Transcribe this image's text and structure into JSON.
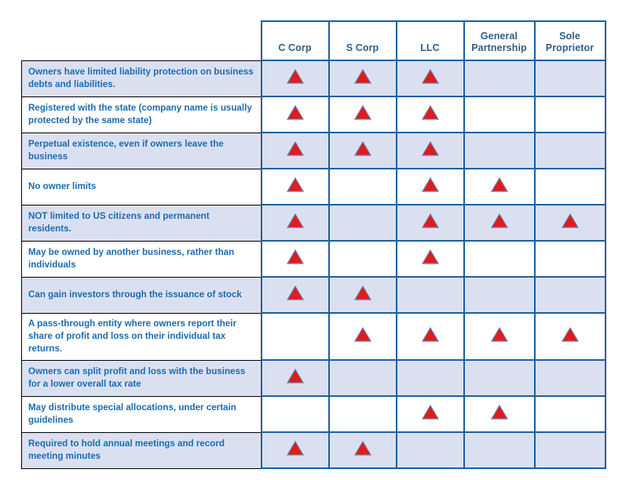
{
  "table": {
    "corner_label": "",
    "columns": [
      {
        "id": "c_corp",
        "label": "C Corp"
      },
      {
        "id": "s_corp",
        "label": "S Corp"
      },
      {
        "id": "llc",
        "label": "LLC"
      },
      {
        "id": "general_partnership",
        "label": "General Partnership"
      },
      {
        "id": "sole_proprietor",
        "label": "Sole Proprietor"
      }
    ],
    "marker": {
      "name": "red-triangle-marker",
      "glyph": "▲",
      "fill_color": "#E21A1A",
      "stroke_color": "#6E7FA8",
      "meaning": "feature applies"
    },
    "colors": {
      "border_blue": "#1A5FA0",
      "border_black": "#000000",
      "row_shaded_background": "#DBE0F1",
      "row_plain_background": "#FFFFFF",
      "header_text": "#2E5E8C",
      "label_text": "#1B6CB0"
    },
    "rows": [
      {
        "label": "Owners have limited liability protection on business debts and liabilities.",
        "shaded": true,
        "marks": [
          true,
          true,
          true,
          false,
          false
        ]
      },
      {
        "label": "Registered with the state (company name is usually protected by the same state)",
        "shaded": false,
        "marks": [
          true,
          true,
          true,
          false,
          false
        ]
      },
      {
        "label": "Perpetual existence, even if owners leave the business",
        "shaded": true,
        "marks": [
          true,
          true,
          true,
          false,
          false
        ]
      },
      {
        "label": "No owner limits",
        "shaded": false,
        "marks": [
          true,
          false,
          true,
          true,
          false
        ]
      },
      {
        "label": "NOT limited to US citizens and permanent residents.",
        "shaded": true,
        "marks": [
          true,
          false,
          true,
          true,
          true
        ]
      },
      {
        "label": "May be owned by another business, rather than individuals",
        "shaded": false,
        "marks": [
          true,
          false,
          true,
          false,
          false
        ]
      },
      {
        "label": "Can gain investors through the issuance of stock",
        "shaded": true,
        "marks": [
          true,
          true,
          false,
          false,
          false
        ]
      },
      {
        "label": "A pass-through entity where owners report their share of profit and loss on their individual tax returns.",
        "shaded": false,
        "marks": [
          false,
          true,
          true,
          true,
          true
        ]
      },
      {
        "label": "Owners can split profit and loss with the business for a lower overall tax rate",
        "shaded": true,
        "marks": [
          true,
          false,
          false,
          false,
          false
        ]
      },
      {
        "label": "May distribute special allocations, under certain guidelines",
        "shaded": false,
        "marks": [
          false,
          false,
          true,
          true,
          false
        ]
      },
      {
        "label": "Required to hold annual meetings and record meeting minutes",
        "shaded": true,
        "marks": [
          true,
          true,
          false,
          false,
          false
        ]
      }
    ]
  }
}
